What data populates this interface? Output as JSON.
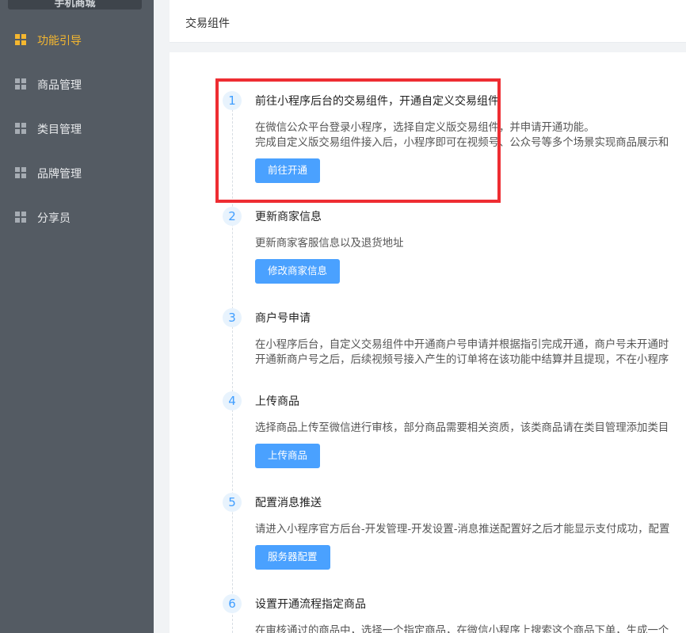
{
  "sidebar": {
    "top_label": "手机商城",
    "items": [
      {
        "label": "功能引导",
        "active": true
      },
      {
        "label": "商品管理",
        "active": false
      },
      {
        "label": "类目管理",
        "active": false
      },
      {
        "label": "品牌管理",
        "active": false
      },
      {
        "label": "分享员",
        "active": false
      }
    ]
  },
  "header": {
    "title": "交易组件"
  },
  "steps": [
    {
      "num": "1",
      "title": "前往小程序后台的交易组件，开通自定义交易组件",
      "desc": [
        "在微信公众平台登录小程序，选择自定义版交易组件，并申请开通功能。",
        "完成自定义版交易组件接入后，小程序即可在视频号、公众号等多个场景实现商品展示和"
      ],
      "button": "前往开通"
    },
    {
      "num": "2",
      "title": "更新商家信息",
      "desc": [
        "更新商家客服信息以及退货地址"
      ],
      "button": "修改商家信息"
    },
    {
      "num": "3",
      "title": "商户号申请",
      "desc": [
        "在小程序后台，自定义交易组件中开通商户号申请并根据指引完成开通，商户号未开通时",
        "开通新商户号之后，后续视频号接入产生的订单将在该功能中结算并且提现，不在小程序"
      ],
      "button": ""
    },
    {
      "num": "4",
      "title": "上传商品",
      "desc": [
        "选择商品上传至微信进行审核，部分商品需要相关资质，该类商品请在类目管理添加类目"
      ],
      "button": "上传商品"
    },
    {
      "num": "5",
      "title": "配置消息推送",
      "desc": [
        "请进入小程序官方后台-开发管理-开发设置-消息推送配置好之后才能显示支付成功，配置"
      ],
      "button": "服务器配置"
    },
    {
      "num": "6",
      "title": "设置开通流程指定商品",
      "desc": [
        "在审核通过的商品中，选择一个指定商品，在微信小程序上搜索这个商品下单，生成一个"
      ],
      "button": ""
    }
  ],
  "colors": {
    "sidebar_bg": "#545b63",
    "active": "#f5b72f",
    "primary": "#4aa1ff",
    "highlight": "#ee2d32"
  }
}
